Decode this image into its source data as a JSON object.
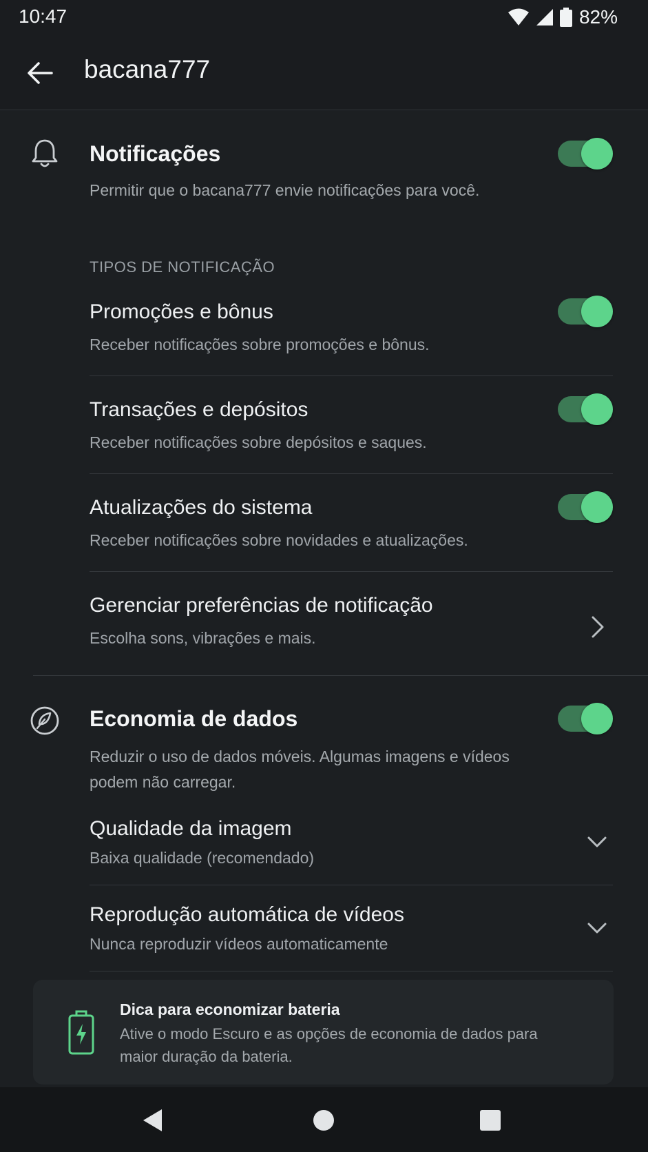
{
  "status": {
    "time": "10:47",
    "battery": "82%"
  },
  "appbar": {
    "title": "bacana777"
  },
  "notifications": {
    "title": "Notificações",
    "description": "Permitir que o bacana777 envie notificações para você.",
    "enabled": true,
    "types_header": "TIPOS DE NOTIFICAÇÃO",
    "items": [
      {
        "title": "Promoções e bônus",
        "subtitle": "Receber notificações sobre promoções e bônus.",
        "enabled": true
      },
      {
        "title": "Transações e depósitos",
        "subtitle": "Receber notificações sobre depósitos e saques.",
        "enabled": true
      },
      {
        "title": "Atualizações do sistema",
        "subtitle": "Receber notificações sobre novidades e atualizações.",
        "enabled": true
      }
    ],
    "manage": {
      "title": "Gerenciar preferências de notificação",
      "subtitle": "Escolha sons, vibrações e mais."
    }
  },
  "data_saver": {
    "title": "Economia de dados",
    "description": "Reduzir o uso de dados móveis. Algumas imagens e vídeos podem não carregar.",
    "enabled": true,
    "image_quality": {
      "title": "Qualidade da imagem",
      "value": "Baixa qualidade (recomendado)"
    },
    "autoplay": {
      "title": "Reprodução automática de vídeos",
      "value": "Nunca reproduzir vídeos automaticamente"
    }
  },
  "tip": {
    "title": "Dica para economizar bateria",
    "text": "Ative o modo Escuro e as opções de economia de dados para maior duração da bateria."
  },
  "colors": {
    "accent": "#5dd48b",
    "accent_track": "#3c7a55",
    "background": "#1c1f22"
  }
}
